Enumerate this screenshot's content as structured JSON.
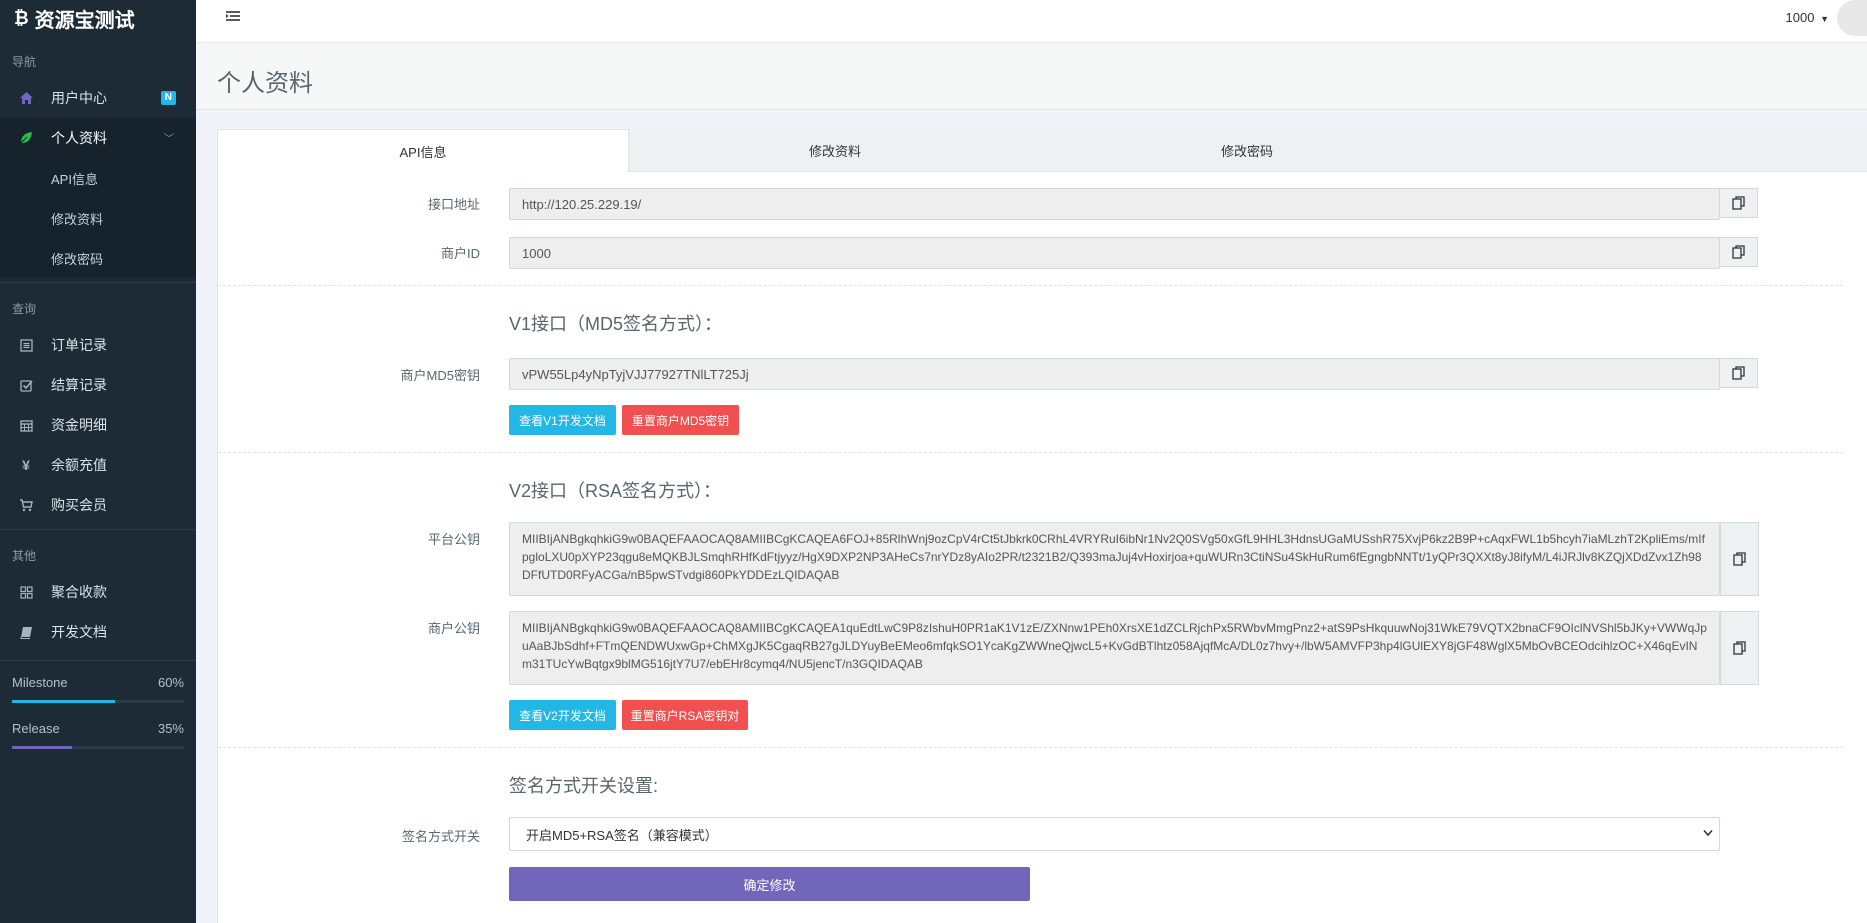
{
  "brand": {
    "title": "资源宝测试",
    "icon": "bitcoin-icon"
  },
  "sidebar": {
    "nav_header": "导航",
    "user_center": {
      "label": "用户中心",
      "badge": "N",
      "icon": "home-icon"
    },
    "profile": {
      "label": "个人资料",
      "icon": "leaf-icon"
    },
    "sub_items": [
      "API信息",
      "修改资料",
      "修改密码"
    ],
    "query_header": "查询",
    "query_items": [
      {
        "label": "订单记录",
        "icon": "list-icon"
      },
      {
        "label": "结算记录",
        "icon": "check-square-icon"
      },
      {
        "label": "资金明细",
        "icon": "calendar-icon"
      },
      {
        "label": "余额充值",
        "icon": "yen-icon"
      },
      {
        "label": "购买会员",
        "icon": "cart-icon"
      }
    ],
    "other_header": "其他",
    "other_items": [
      {
        "label": "聚合收款",
        "icon": "grid-icon"
      },
      {
        "label": "开发文档",
        "icon": "book-icon"
      }
    ],
    "progress": [
      {
        "label": "Milestone",
        "value": "60%",
        "fraction": 0.6,
        "color": "#23b7e5"
      },
      {
        "label": "Release",
        "value": "35%",
        "fraction": 0.35,
        "color": "#7266ba"
      }
    ]
  },
  "topbar": {
    "user": "1000"
  },
  "page": {
    "title": "个人资料"
  },
  "tabs": [
    "API信息",
    "修改资料",
    "修改密码"
  ],
  "form": {
    "api_url_label": "接口地址",
    "api_url": "http://120.25.229.19/",
    "merchant_id_label": "商户ID",
    "merchant_id": "1000",
    "v1_title": "V1接口（MD5签名方式）：",
    "md5_label": "商户MD5密钥",
    "md5_key": "vPW55Lp4yNpTyjVJJ77927TNlLT725Jj",
    "v1_doc_button": "查看V1开发文档",
    "v1_reset_button": "重置商户MD5密钥",
    "v2_title": "V2接口（RSA签名方式）：",
    "platform_key_label": "平台公钥",
    "platform_key": "MIIBIjANBgkqhkiG9w0BAQEFAAOCAQ8AMIIBCgKCAQEA6FOJ+85RlhWnj9ozCpV4rCt5tJbkrk0CRhL4VRYRuI6ibNr1Nv2Q0SVg50xGfL9HHL3HdnsUGaMUSshR75XvjP6kz2B9P+cAqxFWL1b5hcyh7iaMLzhT2KpliEms/mIfpgloLXU0pXYP23qgu8eMQKBJLSmqhRHfKdFtjyyz/HgX9DXP2NP3AHeCs7nrYDz8yAIo2PR/t2321B2/Q393maJuj4vHoxirjoa+quWURn3CtiNSu4SkHuRum6fEgngbNNTt/1yQPr3QXXt8yJ8ifyM/L4iJRJlv8KZQjXDdZvx1Zh98DFfUTD0RFyACGa/nB5pwSTvdgi860PkYDDEzLQIDAQAB",
    "merchant_key_label": "商户公钥",
    "merchant_key": "MIIBIjANBgkqhkiG9w0BAQEFAAOCAQ8AMIIBCgKCAQEA1quEdtLwC9P8zIshuH0PR1aK1V1zE/ZXNnw1PEh0XrsXE1dZCLRjchPx5RWbvMmgPnz2+atS9PsHkquuwNoj31WkE79VQTX2bnaCF9OIclNVShl5bJKy+VWWqJpuAaBJbSdhf+FTmQENDWUxwGp+ChMXgJK5CgaqRB27gJLDYuyBeEMeo6mfqkSO1YcaKgZWWneQjwcL5+KvGdBTlhtz058AjqfMcA/DL0z7hvy+/lbW5AMVFP3hp4lGUlEXY8jGF48WglX5MbOvBCEOdcihlzOC+X46qEvINm31TUcYwBqtgx9blMG516jtY7U7/ebEHr8cymq4/NU5jencT/n3GQIDAQAB",
    "v2_doc_button": "查看V2开发文档",
    "v2_reset_button": "重置商户RSA密钥对",
    "sign_title": "签名方式开关设置:",
    "sign_label": "签名方式开关",
    "sign_value": "开启MD5+RSA签名（兼容模式）",
    "submit_button": "确定修改"
  }
}
